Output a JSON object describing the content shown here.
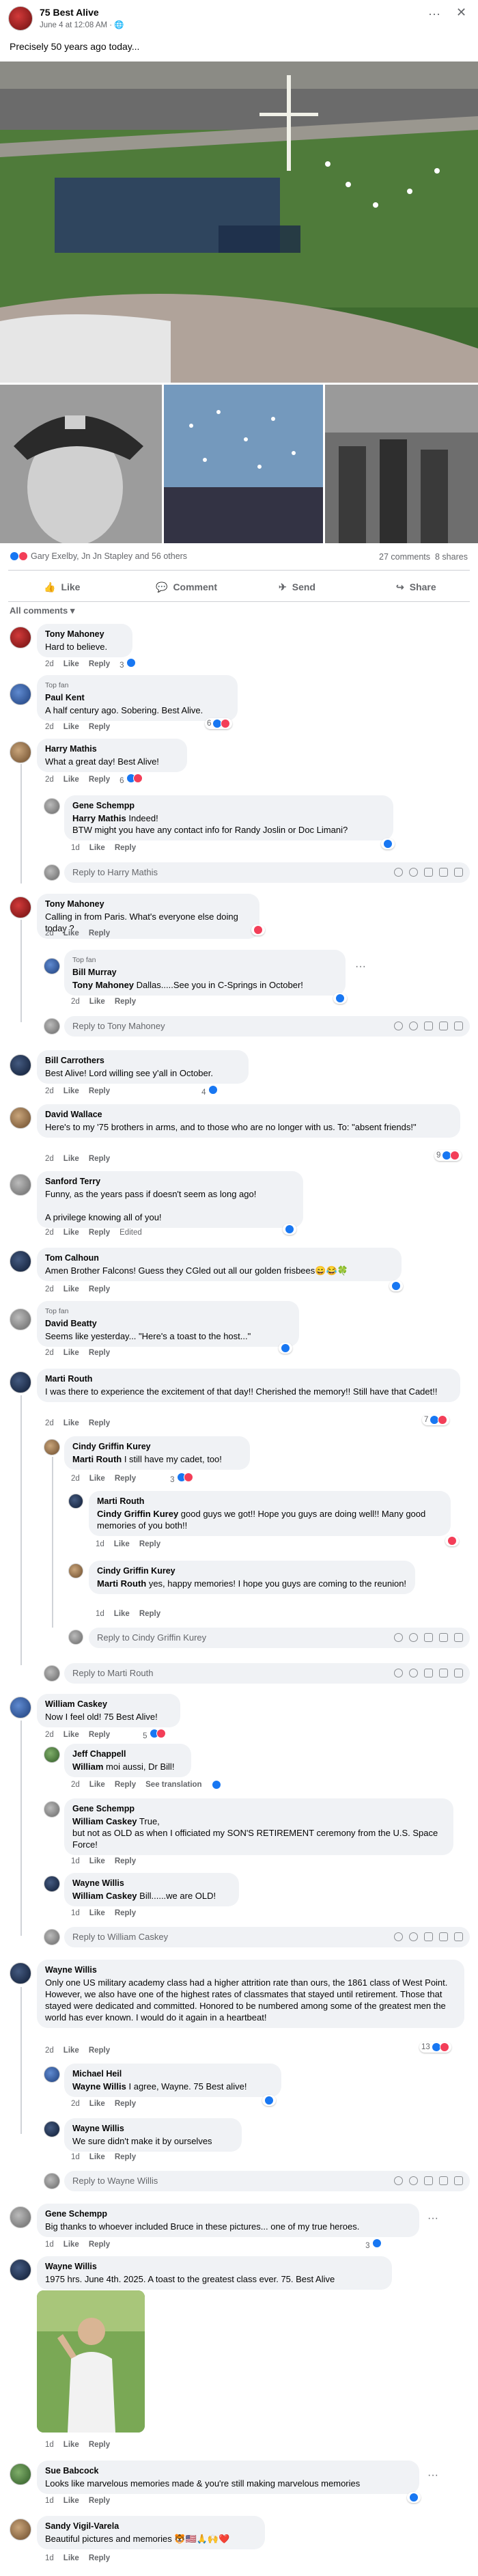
{
  "post": {
    "page_name": "75 Best Alive",
    "timestamp": "June 4 at 12:08 AM · ",
    "text": "Precisely 50 years ago today...",
    "reactions_text": "Gary Exelby, Jn Jn Stapley and 56 others",
    "comments_count": "27 comments",
    "shares_count": "8 shares",
    "actions": {
      "like": "Like",
      "comment": "Comment",
      "send": "Send",
      "share": "Share"
    },
    "filter_label": "All comments"
  },
  "labels": {
    "like": "Like",
    "reply": "Reply",
    "edited": "Edited",
    "see_translation": "See translation"
  },
  "comments": [
    {
      "name": "Tony Mahoney",
      "text": "Hard to believe.",
      "time": "2d",
      "count": "3"
    },
    {
      "name": "Paul Kent",
      "fan": "Top fan",
      "text": "A half century ago. Sobering. Best Alive.",
      "time": "2d",
      "count": "6"
    },
    {
      "name": "Harry Mathis",
      "text": "What a great day! Best Alive!",
      "time": "2d",
      "count": "6"
    },
    {
      "name": "Gene Schempp",
      "mention": "Harry Mathis",
      "text": " Indeed!",
      "text2": "BTW might you have any contact info for Randy Joslin or Doc Limani?",
      "time": "1d"
    },
    {
      "name": "Tony Mahoney",
      "text": "Calling in from Paris. What's everyone else doing today ?",
      "time": "2d"
    },
    {
      "name": "Bill Murray",
      "fan": "Top fan",
      "mention": "Tony Mahoney",
      "text": " Dallas.....See you in C-Springs in October!",
      "time": "2d"
    },
    {
      "name": "Bill Carrothers",
      "text": "Best Alive! Lord willing see y'all in October.",
      "time": "2d",
      "count": "4"
    },
    {
      "name": "David Wallace",
      "text": "Here's to my '75 brothers in arms, and to those who are no longer with us. To: \"absent friends!\"",
      "time": "2d",
      "count": "9"
    },
    {
      "name": "Sanford Terry",
      "text": "Funny, as the years pass if doesn't seem as long ago!",
      "text2": "A privilege knowing all of you!",
      "time": "2d"
    },
    {
      "name": "Tom Calhoun",
      "text": "Amen Brother Falcons! Guess they CGled out all our golden frisbees",
      "emoji": "😄😂🍀",
      "time": "2d"
    },
    {
      "name": "David Beatty",
      "fan": "Top fan",
      "text": "Seems like yesterday... \"Here's a toast to the host...\"",
      "time": "2d"
    },
    {
      "name": "Marti Routh",
      "text": "I was there to experience the excitement of that day!! Cherished the memory!! Still have that Cadet!!",
      "time": "2d",
      "count": "7"
    },
    {
      "name": "Cindy Griffin Kurey",
      "mention": "Marti Routh",
      "text": " I still have my cadet, too!",
      "time": "2d",
      "count": "3"
    },
    {
      "name": "Marti Routh",
      "mention": "Cindy Griffin Kurey",
      "text": " good guys we got!! Hope you guys are doing well!! Many good memories of you both!!",
      "time": "1d"
    },
    {
      "name": "Cindy Griffin Kurey",
      "mention": "Marti Routh",
      "text": " yes, happy memories! I hope you guys are coming to the reunion!",
      "time": "1d"
    },
    {
      "name": "William Caskey",
      "text": "Now I feel old! 75 Best Alive!",
      "time": "2d",
      "count": "5"
    },
    {
      "name": "Jeff Chappell",
      "mention": "William",
      "text": " moi aussi, Dr Bill!",
      "time": "2d"
    },
    {
      "name": "Gene Schempp",
      "mention": "William Caskey",
      "text": " True,",
      "text2": "but not as OLD as when I officiated my SON'S RETIREMENT ceremony from the U.S. Space Force!",
      "time": "1d"
    },
    {
      "name": "Wayne Willis",
      "mention": "William Caskey",
      "text": " Bill......we are OLD!",
      "time": "1d"
    },
    {
      "name": "Wayne Willis",
      "text": "Only one US military academy class had a higher attrition rate than ours, the 1861 class of West Point. However, we also have one of the highest rates of classmates that stayed until retirement. Those that stayed were dedicated and committed. Honored to be numbered among some of the greatest men the world has ever known. I would do it again in a heartbeat!",
      "time": "2d",
      "count": "13"
    },
    {
      "name": "Michael Heil",
      "mention": "Wayne Willis",
      "text": " I agree, Wayne. 75 Best alive!",
      "time": "2d"
    },
    {
      "name": "Wayne Willis",
      "text": "We sure didn't make it by ourselves",
      "time": "1d"
    },
    {
      "name": "Gene Schempp",
      "text": "Big thanks to whoever included Bruce in these pictures... one of my true heroes.",
      "time": "1d",
      "count": "3"
    },
    {
      "name": "Wayne Willis",
      "text": "1975 hrs. June 4th. 2025. A toast to the greatest class ever. 75. Best Alive",
      "time": "1d"
    },
    {
      "name": "Sue Babcock",
      "text": "Looks like marvelous memories made & you're still making marvelous memories",
      "time": "1d"
    },
    {
      "name": "Sandy Vigil-Varela",
      "text": "Beautiful pictures and memories ",
      "emoji": "🐯🇺🇸🙏🙌❤️",
      "time": "1d"
    }
  ],
  "reply_prompts": {
    "harry": "Reply to Harry Mathis",
    "tony": "Reply to Tony Mahoney",
    "cindy": "Reply to Cindy Griffin Kurey",
    "marti": "Reply to Marti Routh",
    "william": "Reply to William Caskey",
    "wayne": "Reply to Wayne Willis"
  },
  "colors": {
    "like": "#1877f2",
    "love": "#f33e58",
    "bubble": "#f0f2f5",
    "meta": "#65676b"
  }
}
